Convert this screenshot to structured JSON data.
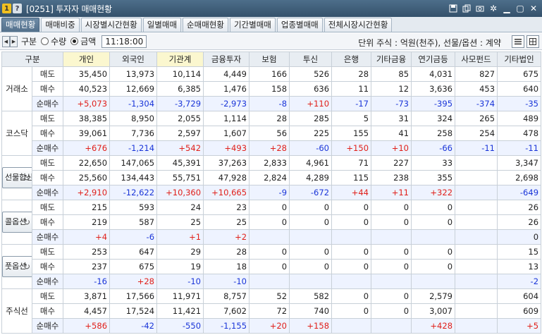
{
  "window": {
    "title": "[0251] 투자자 매매현황",
    "icon1": "1",
    "icon2": "?"
  },
  "tabs": [
    "매매현황",
    "매매비중",
    "시장별시간현황",
    "일별매매",
    "순매매현황",
    "기간별매매",
    "업종별매매",
    "전체시장시간현황"
  ],
  "toolbar": {
    "type_label": "구분",
    "radio_qty": "수량",
    "radio_amount": "금액",
    "time": "11:18:00",
    "unit": "단위 주식 : 억원(천주), 선물/옵션 : 계약"
  },
  "table": {
    "headers": [
      "구분",
      "개인",
      "외국인",
      "기관계",
      "금융투자",
      "보험",
      "투신",
      "은행",
      "기타금융",
      "연기금등",
      "사모펀드",
      "기타법인"
    ],
    "row_labels": [
      "매도",
      "매수",
      "순매수"
    ],
    "groups": [
      {
        "name": "거래소",
        "button": false,
        "rows": [
          [
            "35,450",
            "13,973",
            "10,114",
            "4,449",
            "166",
            "526",
            "28",
            "85",
            "4,031",
            "827",
            "675"
          ],
          [
            "40,523",
            "12,669",
            "6,385",
            "1,476",
            "158",
            "636",
            "11",
            "12",
            "3,636",
            "453",
            "640"
          ],
          [
            "+5,073",
            "-1,304",
            "-3,729",
            "-2,973",
            "-8",
            "+110",
            "-17",
            "-73",
            "-395",
            "-374",
            "-35"
          ]
        ]
      },
      {
        "name": "코스닥",
        "button": false,
        "rows": [
          [
            "38,385",
            "8,950",
            "2,055",
            "1,114",
            "28",
            "285",
            "5",
            "31",
            "324",
            "265",
            "489"
          ],
          [
            "39,061",
            "7,736",
            "2,597",
            "1,607",
            "56",
            "225",
            "155",
            "41",
            "258",
            "254",
            "478"
          ],
          [
            "+676",
            "-1,214",
            "+542",
            "+493",
            "+28",
            "-60",
            "+150",
            "+10",
            "-66",
            "-11",
            "-11"
          ]
        ]
      },
      {
        "name": "선물합산",
        "button": true,
        "rows": [
          [
            "22,650",
            "147,065",
            "45,391",
            "37,263",
            "2,833",
            "4,961",
            "71",
            "227",
            "33",
            "",
            "3,347"
          ],
          [
            "25,560",
            "134,443",
            "55,751",
            "47,928",
            "2,824",
            "4,289",
            "115",
            "238",
            "355",
            "",
            "2,698"
          ],
          [
            "+2,910",
            "-12,622",
            "+10,360",
            "+10,665",
            "-9",
            "-672",
            "+44",
            "+11",
            "+322",
            "",
            "-649"
          ]
        ]
      },
      {
        "name": "콜옵션",
        "button": true,
        "rows": [
          [
            "215",
            "593",
            "24",
            "23",
            "0",
            "0",
            "0",
            "0",
            "0",
            "",
            "26"
          ],
          [
            "219",
            "587",
            "25",
            "25",
            "0",
            "0",
            "0",
            "0",
            "0",
            "",
            "26"
          ],
          [
            "+4",
            "-6",
            "+1",
            "+2",
            "",
            "",
            "",
            "",
            "",
            "",
            "0"
          ]
        ]
      },
      {
        "name": "풋옵션",
        "button": true,
        "rows": [
          [
            "253",
            "647",
            "29",
            "28",
            "0",
            "0",
            "0",
            "0",
            "0",
            "",
            "15"
          ],
          [
            "237",
            "675",
            "19",
            "18",
            "0",
            "0",
            "0",
            "0",
            "0",
            "",
            "13"
          ],
          [
            "-16",
            "+28",
            "-10",
            "-10",
            "",
            "",
            "",
            "",
            "",
            "",
            "-2"
          ]
        ]
      },
      {
        "name": "주식선",
        "button": false,
        "rows": [
          [
            "3,871",
            "17,566",
            "11,971",
            "8,757",
            "52",
            "582",
            "0",
            "0",
            "2,579",
            "",
            "604"
          ],
          [
            "4,457",
            "17,524",
            "11,421",
            "7,602",
            "72",
            "740",
            "0",
            "0",
            "3,007",
            "",
            "609"
          ],
          [
            "+586",
            "-42",
            "-550",
            "-1,155",
            "+20",
            "+158",
            "",
            "",
            "+428",
            "",
            "+5"
          ]
        ]
      }
    ]
  },
  "colors": {
    "positive": "#e0201a",
    "negative": "#1a35d8",
    "header_highlight": "#fbf7cf"
  },
  "icons": [
    "save-icon",
    "copy-icon",
    "camera-icon",
    "gear-icon",
    "minimize-icon",
    "maximize-icon",
    "close-icon",
    "refresh-icon",
    "list-view-icon",
    "grid-view-icon",
    "prev-arrow-icon",
    "next-arrow-icon"
  ]
}
